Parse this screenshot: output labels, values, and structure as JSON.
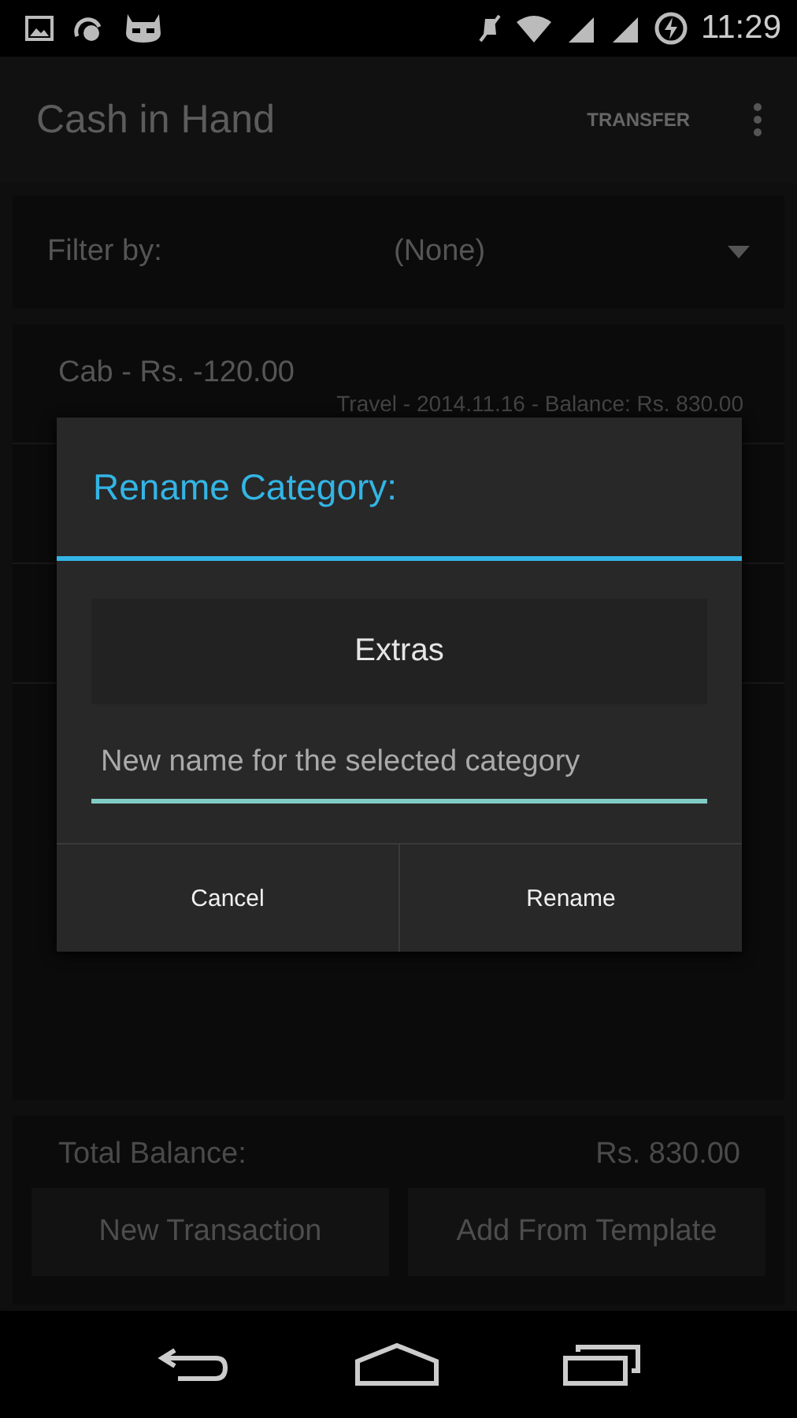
{
  "status_bar": {
    "time": "11:29"
  },
  "app_bar": {
    "title": "Cash in Hand",
    "action": "TRANSFER"
  },
  "filter": {
    "label": "Filter by:",
    "value": "(None)"
  },
  "transactions": [
    {
      "title": "Cab  -  Rs. -120.00",
      "details": "Travel  -  2014.11.16  -  Balance: Rs. 830.00"
    }
  ],
  "footer": {
    "label": "Total Balance:",
    "amount": "Rs. 830.00",
    "buttons": [
      "New Transaction",
      "Add From Template"
    ]
  },
  "dialog": {
    "title": "Rename Category:",
    "category": "Extras",
    "input": {
      "placeholder": "New name for the selected category"
    },
    "buttons": [
      "Cancel",
      "Rename"
    ]
  }
}
